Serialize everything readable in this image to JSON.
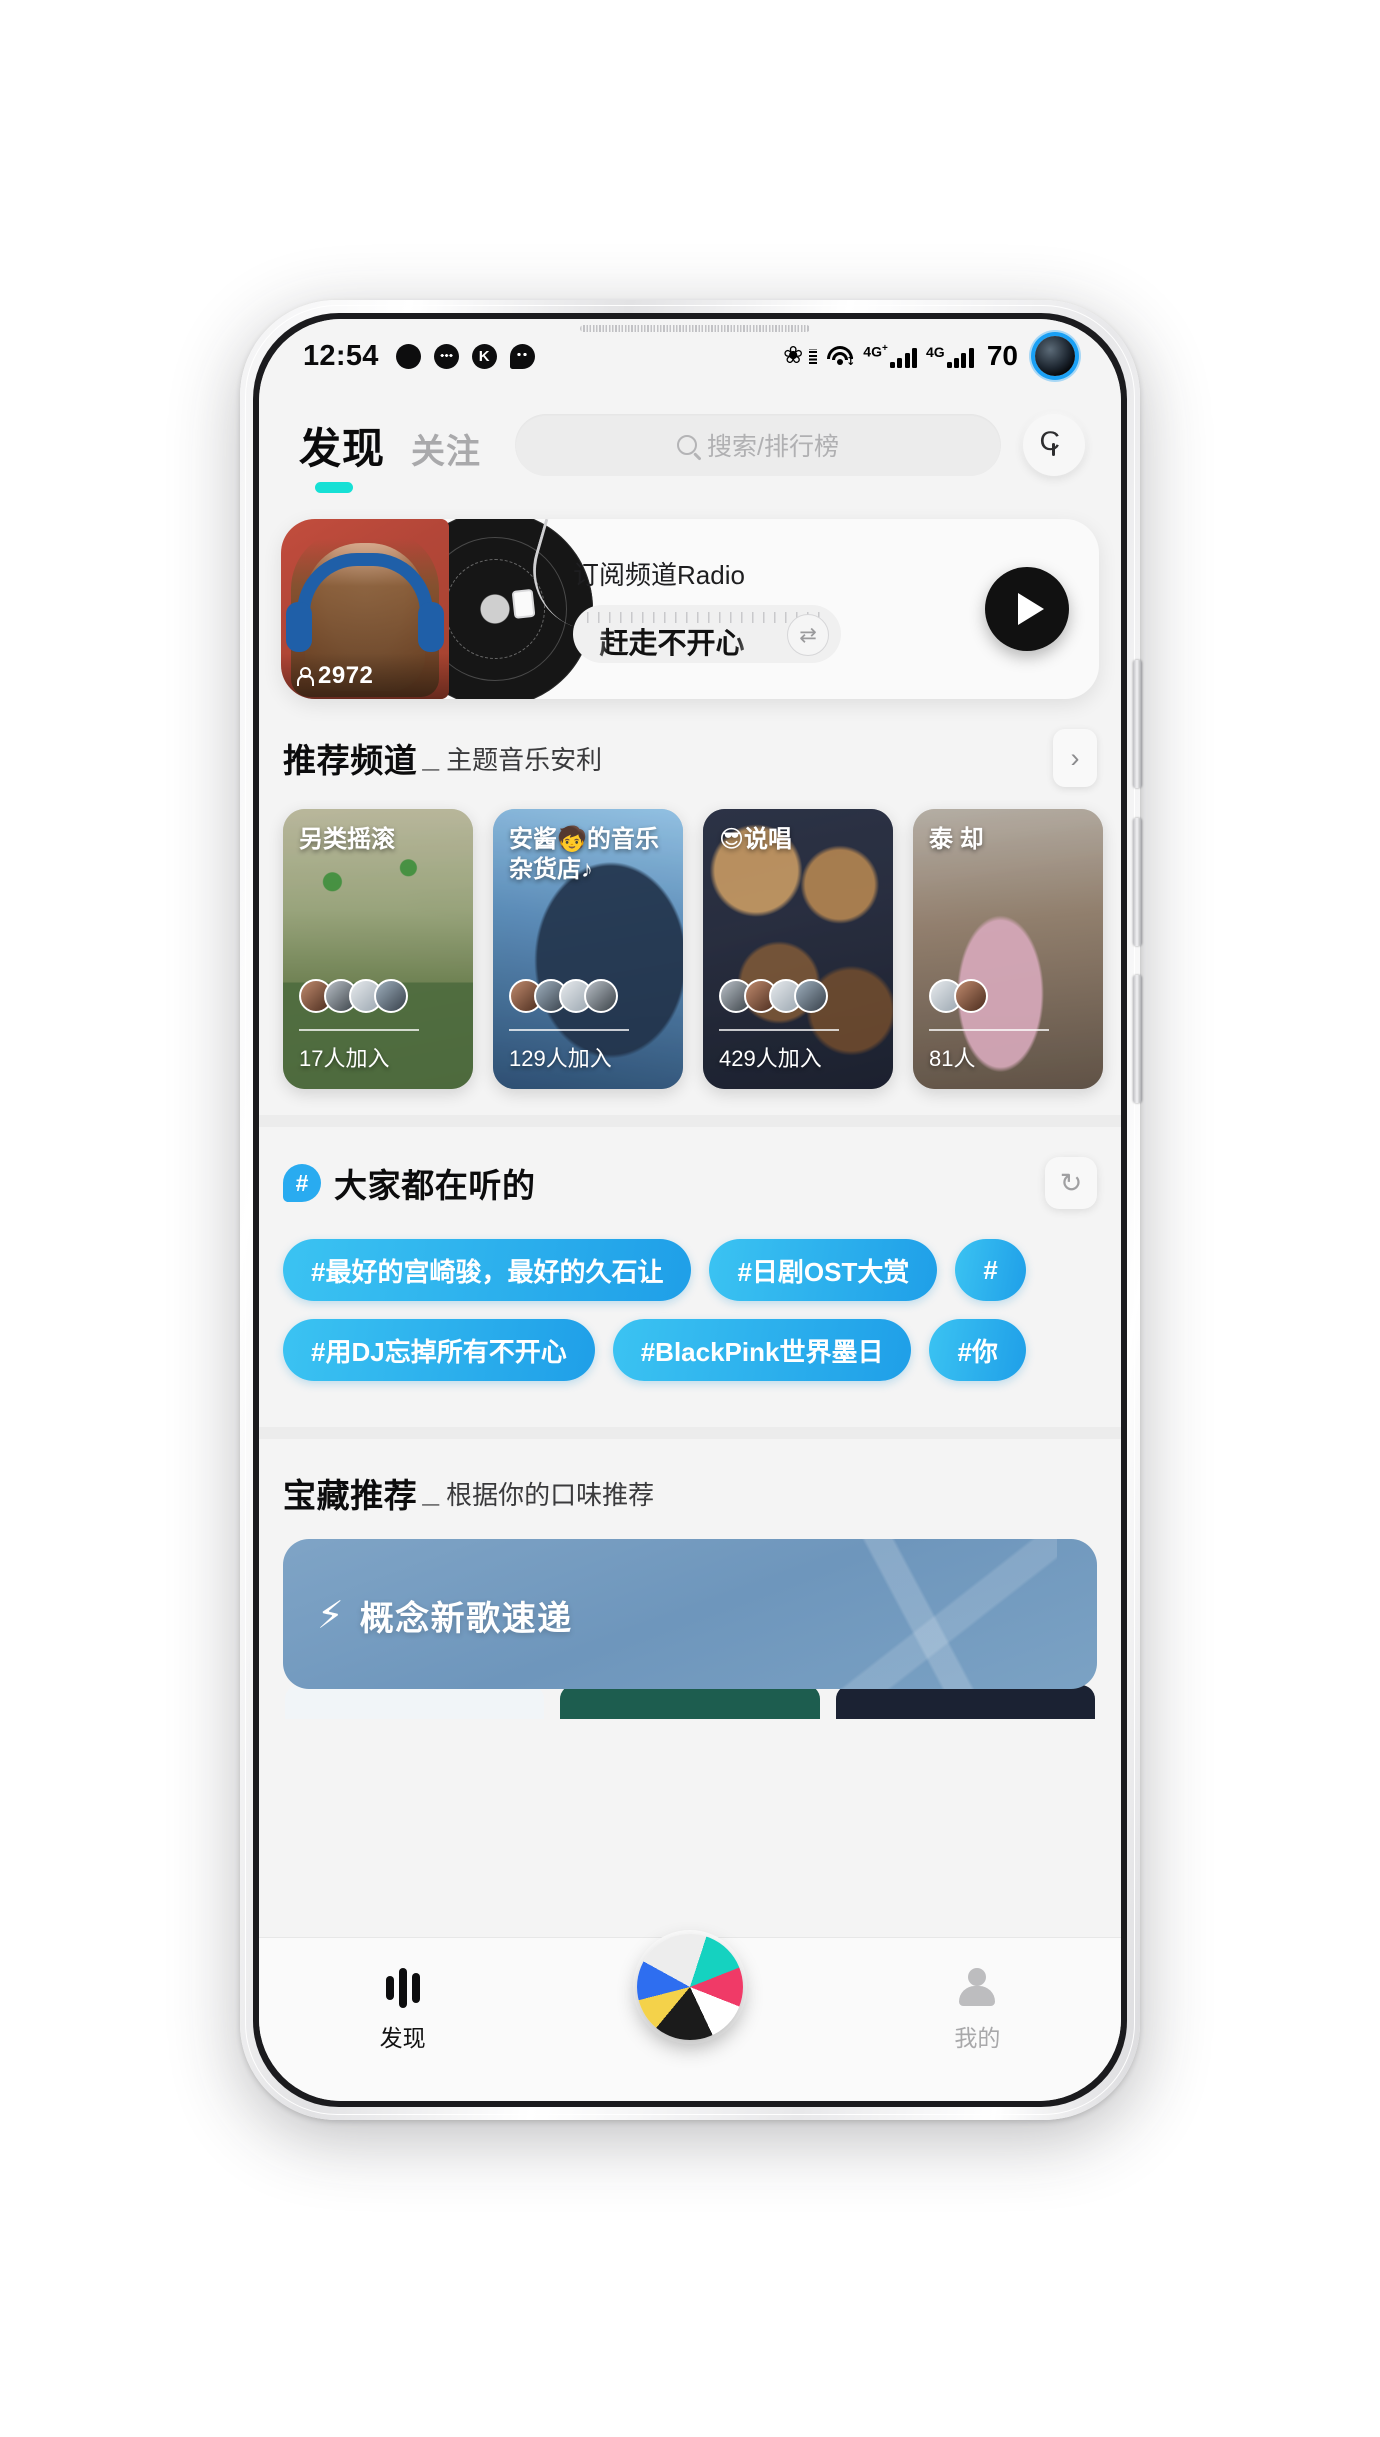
{
  "status_bar": {
    "time": "12:54",
    "notification_icons": [
      "dot-icon",
      "dots-bubble-icon",
      "kuwo-k-icon",
      "wechat-bubble-icon"
    ],
    "bluetooth_icon": "bluetooth-icon",
    "wifi_icon": "wifi-icon",
    "network_1": "4G",
    "network_1_sup": "+",
    "network_2": "4G",
    "battery": "70",
    "camera_punch": "front-camera-punch"
  },
  "header": {
    "tab_active": "发现",
    "tab_inactive": "关注",
    "search_placeholder": "搜索/排行榜",
    "search_icon": "search-icon",
    "voice_button_icon": "voice-search-icon"
  },
  "radio_card": {
    "title": "订阅频道Radio",
    "ticker_text": "赶走不开心",
    "listeners": "2972",
    "person_icon": "person-icon",
    "swap_icon": "⇄",
    "play_icon": "play-icon"
  },
  "channels_section": {
    "title": "推荐频道",
    "dash": "_",
    "subtitle": "主题音乐安利",
    "arrow_icon": "chevron-right-icon",
    "cards": [
      {
        "label": "另类摇滚",
        "join": "17人加入"
      },
      {
        "label": "安酱🧒的音乐\n杂货店♪",
        "join": "129人加入"
      },
      {
        "label": "😎说唱",
        "join": "429人加入"
      },
      {
        "label": "泰\n却",
        "join": "81人"
      }
    ]
  },
  "trending_section": {
    "hash_icon": "#",
    "title": "大家都在听的",
    "refresh_icon": "refresh-icon",
    "tag_rows": [
      [
        "#最好的宫崎骏，最好的久石让",
        "#日剧OST大赏",
        "#"
      ],
      [
        "#用DJ忘掉所有不开心",
        "#BlackPink世界墨日",
        "#你"
      ]
    ]
  },
  "treasure_section": {
    "title": "宝藏推荐",
    "dash": "_",
    "subtitle": "根据你的口味推荐",
    "banner_icon": "⚡",
    "banner_title": "概念新歌速递"
  },
  "bottom_nav": {
    "discover_label": "发现",
    "discover_icon": "waveform-icon",
    "center_icon": "now-playing-album-art",
    "mine_label": "我的",
    "mine_icon": "person-icon"
  },
  "colors": {
    "accent_teal": "#16e0d5",
    "tag_blue": "#1f9fe8",
    "hash_blue": "#29abf0",
    "banner_blue": "#7fa4c6",
    "screen_bg": "#f4f4f4"
  }
}
